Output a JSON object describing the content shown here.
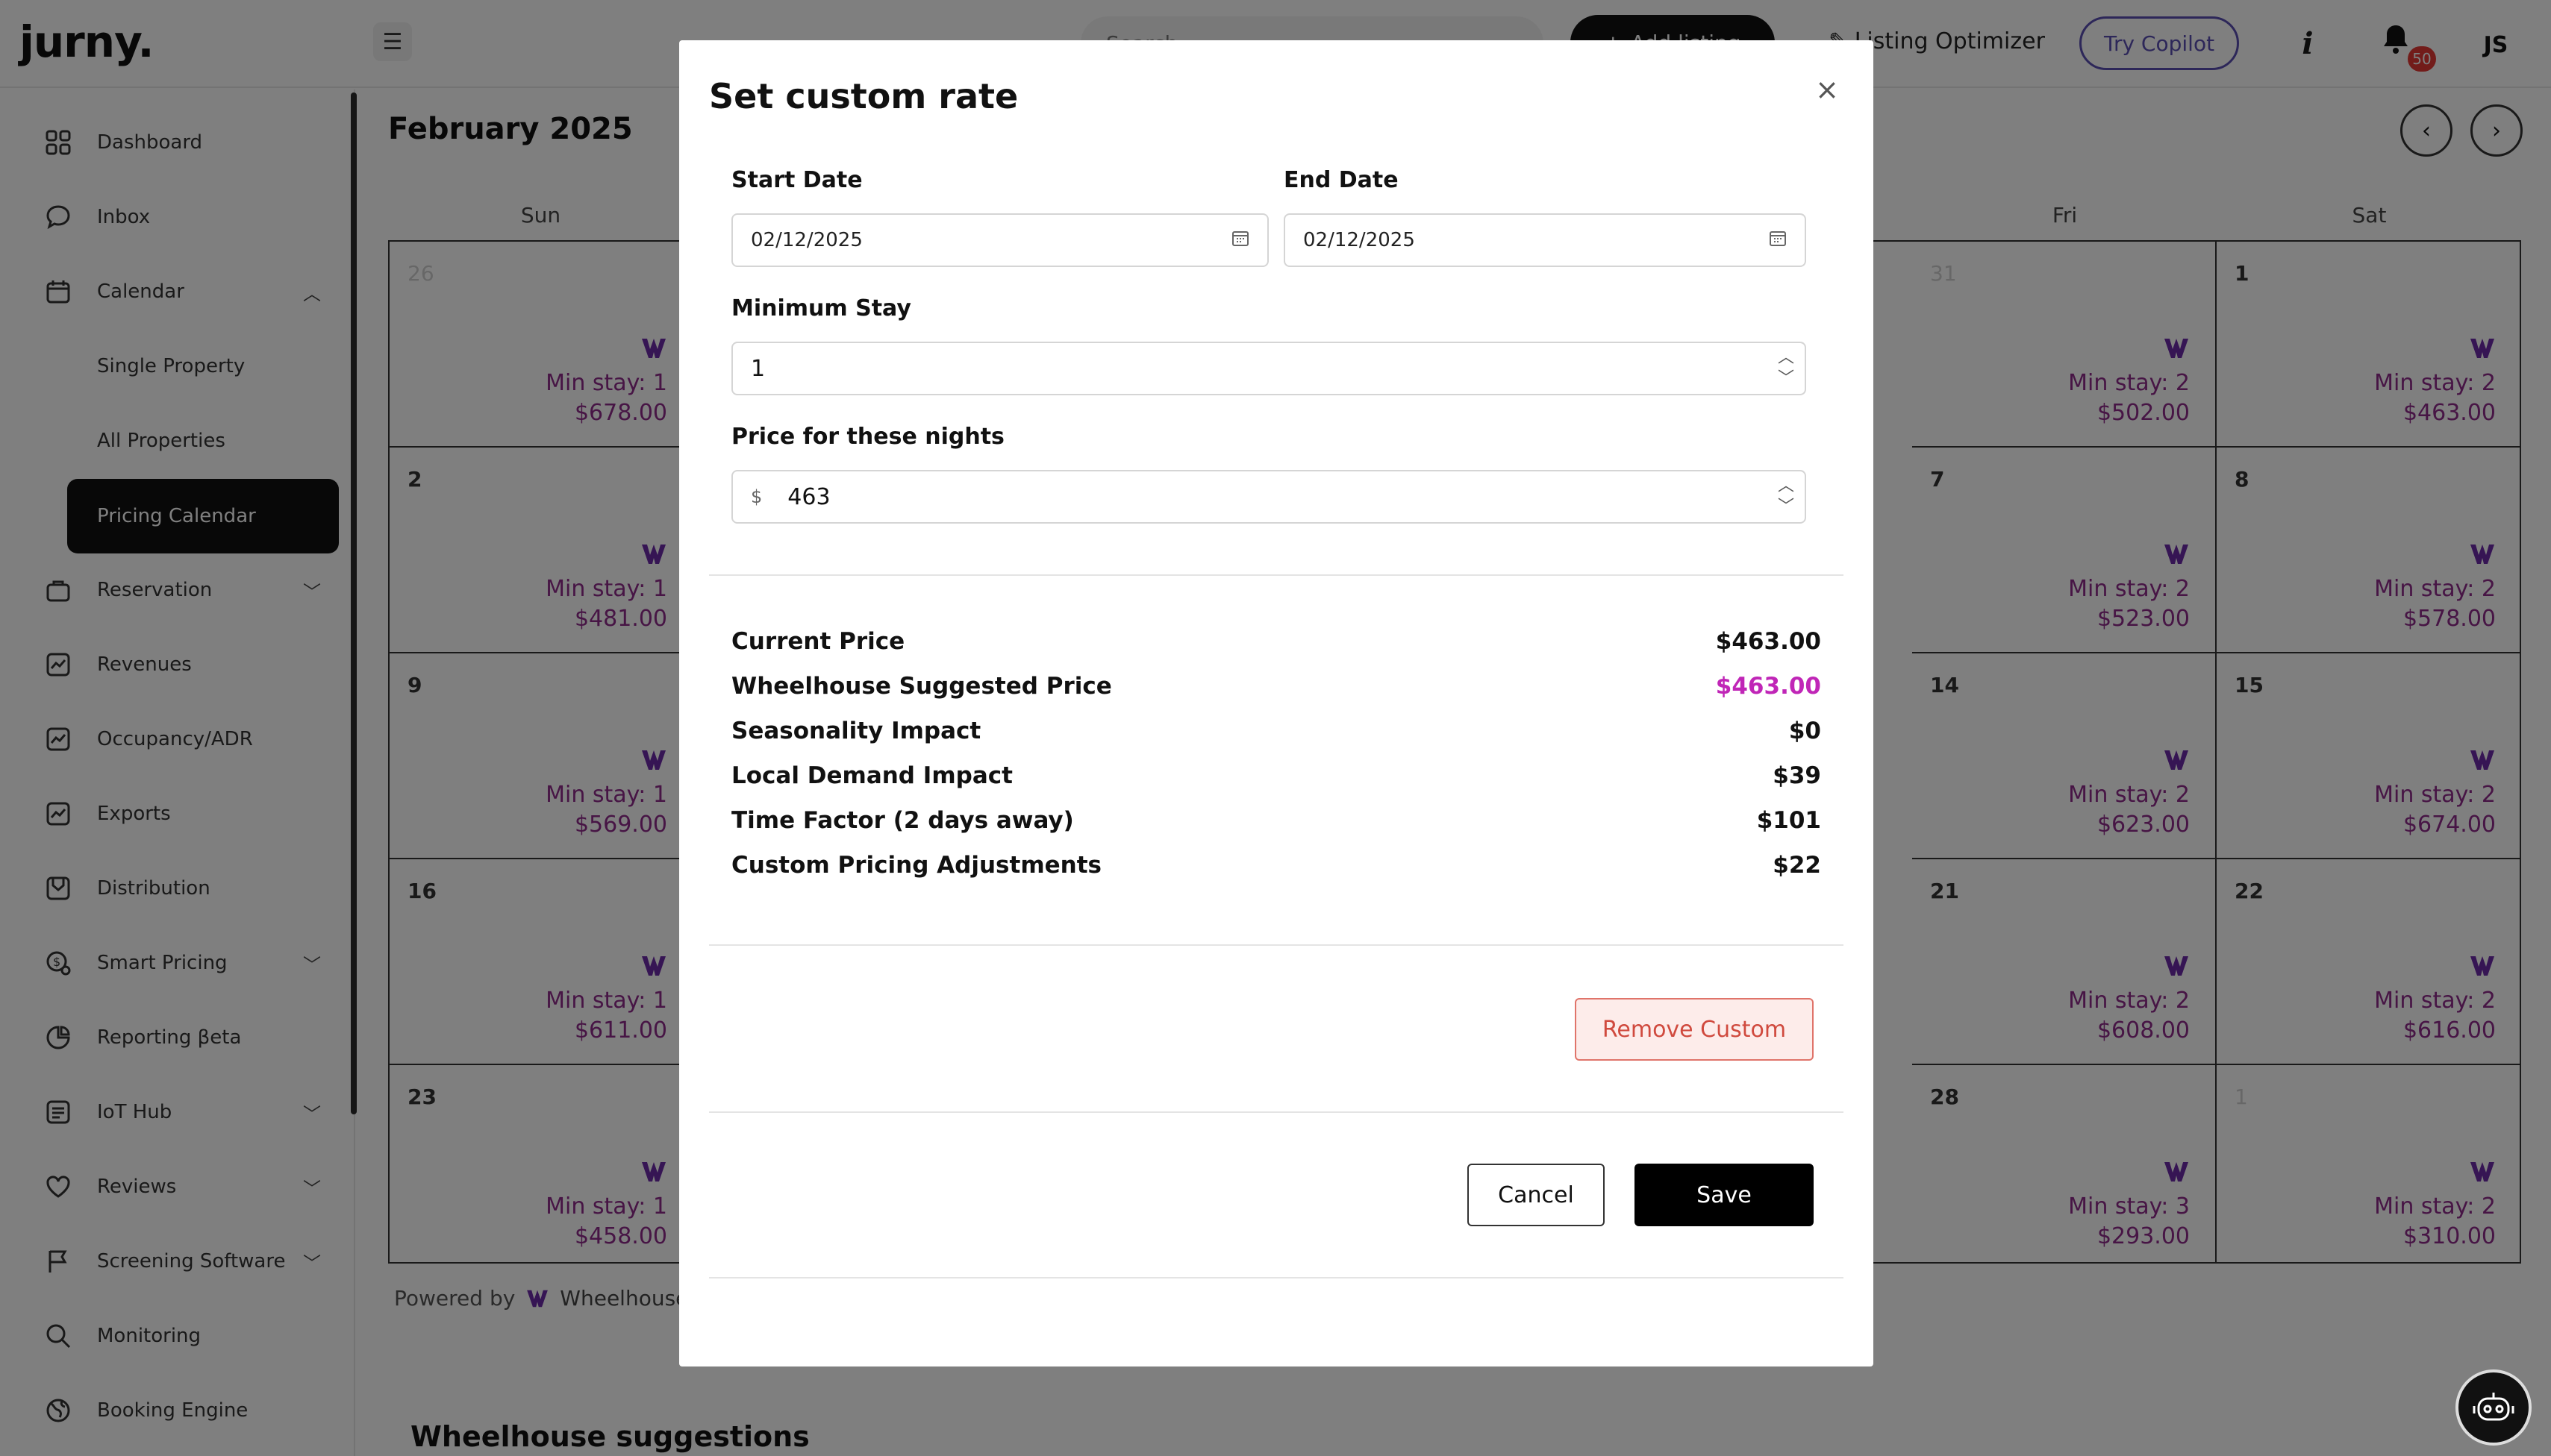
{
  "app": {
    "logo_text": "jurny.",
    "search_placeholder": "Search",
    "add_listing_label": "Add listing",
    "listing_optimizer_label": "Listing Optimizer",
    "try_copilot_label": "Try Copilot",
    "notification_count": "50",
    "user_initials": "JS"
  },
  "sidebar": {
    "items": [
      {
        "label": "Dashboard",
        "icon": "grid-icon"
      },
      {
        "label": "Inbox",
        "icon": "chat-icon"
      },
      {
        "label": "Calendar",
        "icon": "calendar-icon"
      },
      {
        "label": "Reservation",
        "icon": "bag-icon"
      },
      {
        "label": "Revenues",
        "icon": "chart-icon"
      },
      {
        "label": "Occupancy/ADR",
        "icon": "chart-icon"
      },
      {
        "label": "Exports",
        "icon": "chart-icon"
      },
      {
        "label": "Distribution",
        "icon": "distribution-icon"
      },
      {
        "label": "Smart Pricing",
        "icon": "pricing-icon"
      },
      {
        "label": "Reporting βeta",
        "icon": "pie-icon"
      },
      {
        "label": "IoT Hub",
        "icon": "list-icon"
      },
      {
        "label": "Reviews",
        "icon": "heart-icon"
      },
      {
        "label": "Screening Software",
        "icon": "flag-icon"
      },
      {
        "label": "Monitoring",
        "icon": "search-icon"
      },
      {
        "label": "Booking Engine",
        "icon": "globe-icon"
      }
    ],
    "calendar_sub": [
      "Single Property",
      "All Properties",
      "Pricing Calendar"
    ]
  },
  "calendar": {
    "month_title": "February 2025",
    "days_of_week": [
      "Sun",
      "Fri",
      "Sat"
    ],
    "weeks": [
      {
        "sun": {
          "day": "26",
          "muted": true,
          "min_stay": "Min stay: 1",
          "price": "$678.00"
        },
        "fri": {
          "day": "31",
          "muted": true,
          "min_stay": "Min stay: 2",
          "price": "$502.00"
        },
        "sat": {
          "day": "1",
          "muted": false,
          "min_stay": "Min stay: 2",
          "price": "$463.00"
        }
      },
      {
        "sun": {
          "day": "2",
          "muted": false,
          "min_stay": "Min stay: 1",
          "price": "$481.00"
        },
        "fri": {
          "day": "7",
          "muted": false,
          "min_stay": "Min stay: 2",
          "price": "$523.00"
        },
        "sat": {
          "day": "8",
          "muted": false,
          "min_stay": "Min stay: 2",
          "price": "$578.00"
        }
      },
      {
        "sun": {
          "day": "9",
          "muted": false,
          "min_stay": "Min stay: 1",
          "price": "$569.00"
        },
        "fri": {
          "day": "14",
          "muted": false,
          "min_stay": "Min stay: 2",
          "price": "$623.00"
        },
        "sat": {
          "day": "15",
          "muted": false,
          "min_stay": "Min stay: 2",
          "price": "$674.00"
        }
      },
      {
        "sun": {
          "day": "16",
          "muted": false,
          "min_stay": "Min stay: 1",
          "price": "$611.00"
        },
        "fri": {
          "day": "21",
          "muted": false,
          "min_stay": "Min stay: 2",
          "price": "$608.00"
        },
        "sat": {
          "day": "22",
          "muted": false,
          "min_stay": "Min stay: 2",
          "price": "$616.00"
        }
      },
      {
        "sun": {
          "day": "23",
          "muted": false,
          "min_stay": "Min stay: 1",
          "price": "$458.00"
        },
        "fri": {
          "day": "28",
          "muted": false,
          "min_stay": "Min stay: 3",
          "price": "$293.00"
        },
        "sat": {
          "day": "1",
          "muted": true,
          "min_stay": "Min stay: 2",
          "price": "$310.00"
        }
      }
    ],
    "powered_by": "Powered by",
    "powered_brand": "Wheelhouse",
    "suggestions_title": "Wheelhouse suggestions"
  },
  "modal": {
    "title": "Set custom rate",
    "start_date_label": "Start Date",
    "start_date_value": "02/12/2025",
    "end_date_label": "End Date",
    "end_date_value": "02/12/2025",
    "min_stay_label": "Minimum Stay",
    "min_stay_value": "1",
    "price_label": "Price for these nights",
    "currency_prefix": "$",
    "price_value": "463",
    "breakdown": [
      {
        "label": "Current Price",
        "value": "$463.00",
        "accent": false
      },
      {
        "label": "Wheelhouse Suggested Price",
        "value": "$463.00",
        "accent": true
      },
      {
        "label": "Seasonality Impact",
        "value": "$0",
        "accent": false
      },
      {
        "label": "Local Demand Impact",
        "value": "$39",
        "accent": false
      },
      {
        "label": "Time Factor (2 days away)",
        "value": "$101",
        "accent": false
      },
      {
        "label": "Custom Pricing Adjustments",
        "value": "$22",
        "accent": false
      }
    ],
    "remove_label": "Remove Custom",
    "cancel_label": "Cancel",
    "save_label": "Save"
  },
  "colors": {
    "accent": "#c026b7",
    "price_text": "#8e2a8a",
    "remove_border": "#e0746a"
  }
}
